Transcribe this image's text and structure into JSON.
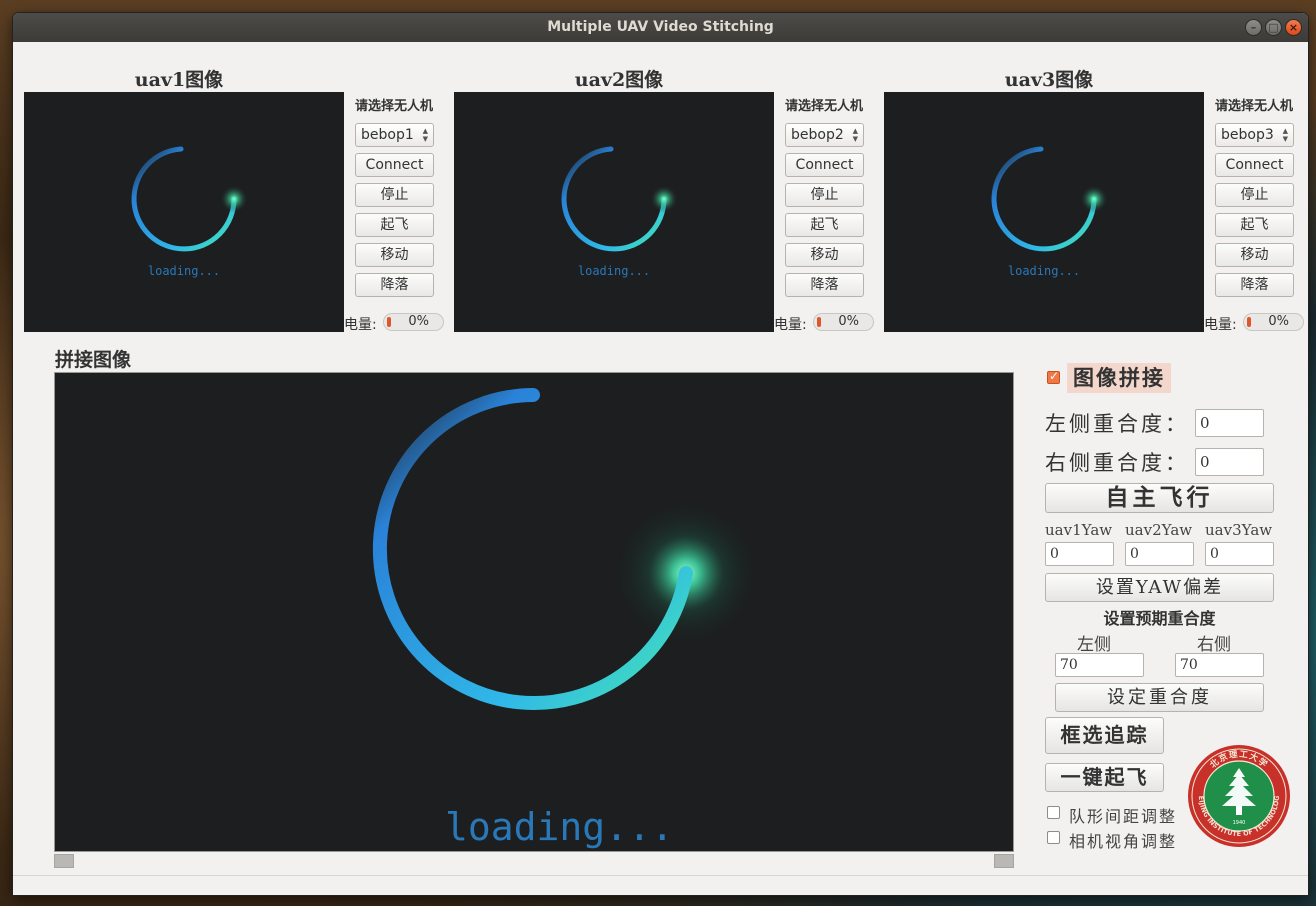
{
  "window": {
    "title": "Multiple UAV Video Stitching"
  },
  "uavs": [
    {
      "title": "uav1图像",
      "select_label": "请选择无人机",
      "drone": "bebop1",
      "connect": "Connect",
      "stop": "停止",
      "takeoff": "起飞",
      "move": "移动",
      "land": "降落",
      "battery_label": "电量:",
      "battery": "0%",
      "battery_fraction": 0.0,
      "loading": "loading..."
    },
    {
      "title": "uav2图像",
      "select_label": "请选择无人机",
      "drone": "bebop2",
      "connect": "Connect",
      "stop": "停止",
      "takeoff": "起飞",
      "move": "移动",
      "land": "降落",
      "battery_label": "电量:",
      "battery": "0%",
      "battery_fraction": 0.0,
      "loading": "loading..."
    },
    {
      "title": "uav3图像",
      "select_label": "请选择无人机",
      "drone": "bebop3",
      "connect": "Connect",
      "stop": "停止",
      "takeoff": "起飞",
      "move": "移动",
      "land": "降落",
      "battery_label": "电量:",
      "battery": "0%",
      "battery_fraction": 0.0,
      "loading": "loading..."
    }
  ],
  "stitch": {
    "title": "拼接图像",
    "loading": "loading..."
  },
  "right_panel": {
    "stitch_checkbox": "图像拼接",
    "left_overlap_label": "左侧重合度：",
    "left_overlap_value": "0",
    "right_overlap_label": "右侧重合度：",
    "right_overlap_value": "0",
    "autonomous_button": "自主飞行",
    "yaw_labels": [
      "uav1Yaw",
      "uav2Yaw",
      "uav3Yaw"
    ],
    "yaw_values": [
      "0",
      "0",
      "0"
    ],
    "set_yaw_button": "设置YAW偏差",
    "expected_overlap_title": "设置预期重合度",
    "left_label": "左侧",
    "right_label": "右侧",
    "left_expected": "70",
    "right_expected": "70",
    "set_overlap_button": "设定重合度",
    "box_track_button": "框选追踪",
    "one_key_takeoff_button": "一键起飞",
    "formation_checkbox": "队形间距调整",
    "camera_checkbox": "相机视角调整"
  },
  "logo": {
    "text": "BEIJING INSTITUTE OF TECHNOLOGY",
    "year": "1940",
    "cn": "北京理工大学"
  },
  "colors": {
    "accent": "#f07746",
    "video_bg": "#1c1e1f",
    "spinner_start": "#2a82d8",
    "spinner_end": "#46e8b0",
    "logo_red": "#c8302a",
    "logo_green": "#1f8f4a"
  }
}
